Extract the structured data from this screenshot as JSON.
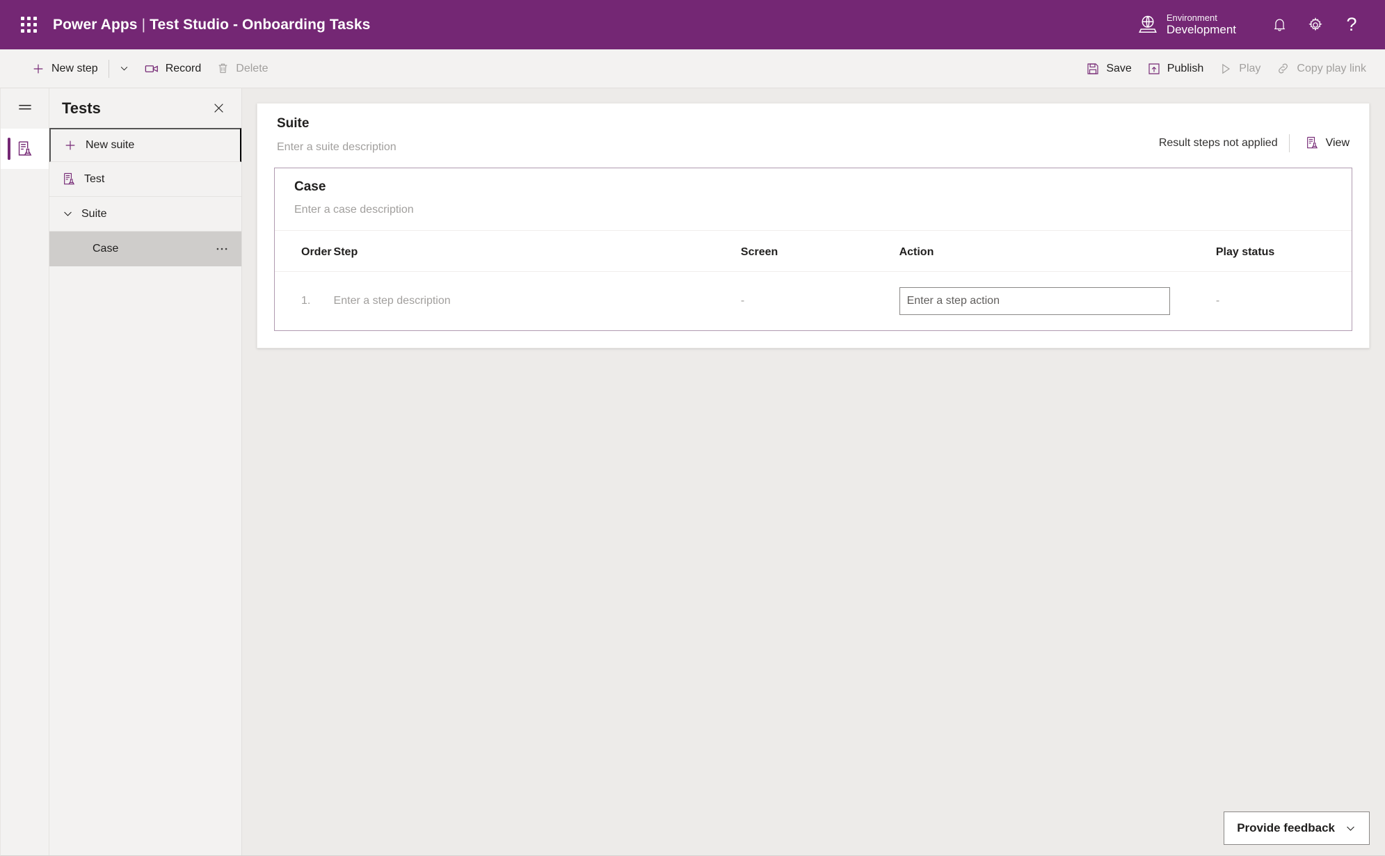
{
  "brand": {
    "waffle_icon": "app-launcher-icon",
    "product": "Power Apps",
    "separator": "|",
    "app_title": "Test Studio - Onboarding Tasks",
    "environment_label": "Environment",
    "environment_value": "Development",
    "environment_icon": "globe-icon",
    "notifications_icon": "bell-icon",
    "settings_icon": "gear-icon",
    "help_icon": "question-mark-icon",
    "background_color": "#742774"
  },
  "commandbar": {
    "new_step": "New step",
    "new_step_icon": "plus-icon",
    "new_step_caret_icon": "chevron-down-icon",
    "record": "Record",
    "record_icon": "video-camera-icon",
    "delete": "Delete",
    "delete_icon": "trash-icon",
    "delete_disabled": true,
    "save": "Save",
    "save_icon": "floppy-disk-icon",
    "publish": "Publish",
    "publish_icon": "publish-upload-icon",
    "play": "Play",
    "play_icon": "play-triangle-icon",
    "play_disabled": true,
    "copy_play_link": "Copy play link",
    "copy_play_link_icon": "link-chain-icon",
    "copy_play_link_disabled": true
  },
  "rail": {
    "hamburger_icon": "hamburger-menu-icon",
    "tests_icon": "test-beaker-icon"
  },
  "tests_panel": {
    "title": "Tests",
    "close_icon": "close-x-icon",
    "new_suite": "New suite",
    "new_suite_icon": "plus-icon",
    "items": [
      {
        "label": "Test",
        "icon": "test-beaker-icon",
        "type": "test",
        "selected": false
      },
      {
        "label": "Suite",
        "icon": "chevron-down-icon",
        "type": "suite",
        "selected": false
      },
      {
        "label": "Case",
        "icon": "",
        "type": "case",
        "selected": true,
        "more_icon": "more-ellipsis-icon"
      }
    ]
  },
  "suite": {
    "title": "Suite",
    "description_placeholder": "Enter a suite description",
    "result_note": "Result steps not applied",
    "view_label": "View",
    "view_icon": "test-beaker-icon"
  },
  "case": {
    "title": "Case",
    "description_placeholder": "Enter a case description",
    "columns": [
      "Order",
      "Step",
      "Screen",
      "Action",
      "Play status"
    ],
    "rows": [
      {
        "order": "1.",
        "step_placeholder": "Enter a step description",
        "screen": "-",
        "action_placeholder": "Enter a step action",
        "action_value": "",
        "play_status": "-"
      }
    ]
  },
  "feedback": {
    "label": "Provide feedback",
    "caret_icon": "chevron-down-icon"
  },
  "colors": {
    "brand_purple": "#742774",
    "case_border": "#b09ab0",
    "canvas_bg": "#edebe9",
    "panel_bg": "#f3f2f1",
    "selected_item_bg": "#cfcdcb"
  }
}
